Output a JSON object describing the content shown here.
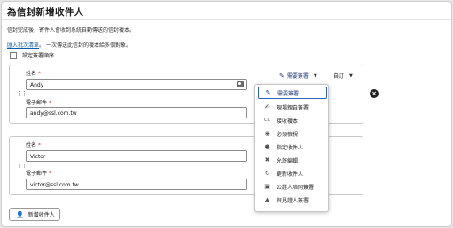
{
  "page": {
    "title": "為信封新增收件人",
    "description": "信封完成後，寄件人會收到系統自動傳送的信封複本。",
    "import_link": "匯入批次清單",
    "import_suffix": "一次傳送此信封的複本給多個對象。",
    "set_order_label": "設定簽署順序"
  },
  "recipients": [
    {
      "name_label": "姓名",
      "name_value": "Andy",
      "email_label": "電子郵件",
      "email_value": "andy@ssl.com.tw",
      "role_label": "需要簽署",
      "custom_label": "自訂"
    },
    {
      "name_label": "姓名",
      "name_value": "Victor",
      "email_label": "電子郵件",
      "email_value": "victor@ssl.com.tw"
    }
  ],
  "required_mark": "*",
  "role_menu": {
    "items": [
      {
        "label": "需要簽署",
        "icon": "pen-icon",
        "glyph": "✎"
      },
      {
        "label": "現場親自簽署",
        "icon": "pen-person-icon",
        "glyph": "✍"
      },
      {
        "label": "接收複本",
        "icon": "cc-icon",
        "glyph": "CC"
      },
      {
        "label": "必須檢視",
        "icon": "eye-icon",
        "glyph": "◉"
      },
      {
        "label": "指定收件人",
        "icon": "person-icon",
        "glyph": "●"
      },
      {
        "label": "允許編輯",
        "icon": "cross-tools-icon",
        "glyph": "✖"
      },
      {
        "label": "更新收件人",
        "icon": "refresh-person-icon",
        "glyph": "↻"
      },
      {
        "label": "公證人陪同簽署",
        "icon": "notary-icon",
        "glyph": "▣"
      },
      {
        "label": "與見證人簽署",
        "icon": "witness-icon",
        "glyph": "▲"
      }
    ],
    "selected_index": 0
  },
  "add_button_label": "新增收件人",
  "colors": {
    "accent": "#2b63c7",
    "link": "#0b5cad",
    "required": "#c23934"
  }
}
